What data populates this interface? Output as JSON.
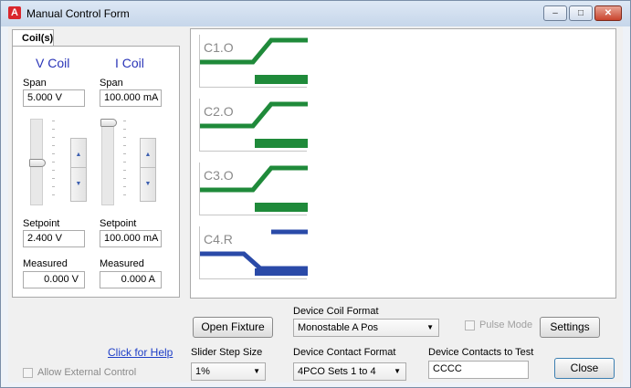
{
  "window": {
    "title": "Manual Control Form",
    "app_icon_letter": "A",
    "buttons": {
      "minimize": "–",
      "maximize": "□",
      "close": "✕"
    }
  },
  "tab": {
    "label": "Coil(s)"
  },
  "coils": {
    "v": {
      "heading": "V Coil",
      "span_label": "Span",
      "span_value": "5.000  V",
      "setpoint_label": "Setpoint",
      "setpoint_value": "2.400  V",
      "measured_label": "Measured",
      "measured_value": "0.000  V",
      "slider_fraction": 0.48
    },
    "i": {
      "heading": "I Coil",
      "span_label": "Span",
      "span_value": "100.000 mA",
      "setpoint_label": "Setpoint",
      "setpoint_value": "100.000 mA",
      "measured_label": "Measured",
      "measured_value": "0.000  A",
      "slider_fraction": 1.0
    },
    "spin_up": "▲",
    "spin_down": "▼"
  },
  "contacts": [
    {
      "label": "C1.O",
      "color": "#1f8a3a",
      "kind": "form-a"
    },
    {
      "label": "C2.O",
      "color": "#1f8a3a",
      "kind": "form-a"
    },
    {
      "label": "C3.O",
      "color": "#1f8a3a",
      "kind": "form-a"
    },
    {
      "label": "C4.R",
      "color": "#2a4aa8",
      "kind": "form-b"
    }
  ],
  "controls": {
    "open_fixture": "Open Fixture",
    "device_coil_format_label": "Device Coil Format",
    "device_coil_format_value": "Monostable A Pos",
    "pulse_mode_label": "Pulse Mode",
    "settings": "Settings",
    "help_link": "Click for Help",
    "slider_step_label": "Slider Step Size",
    "slider_step_value": "1%",
    "device_contact_format_label": "Device Contact Format",
    "device_contact_format_value": "4PCO Sets 1 to 4",
    "device_contacts_test_label": "Device Contacts to Test",
    "device_contacts_test_value": "CCCC",
    "close": "Close",
    "allow_external": "Allow External Control"
  }
}
